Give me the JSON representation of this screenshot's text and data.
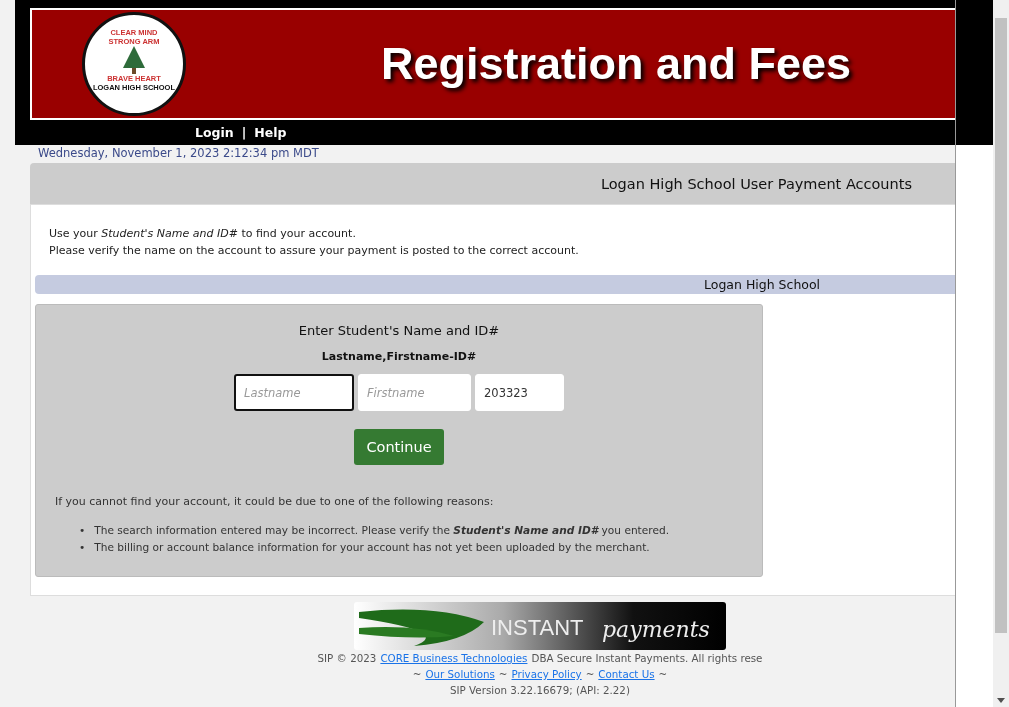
{
  "banner": {
    "title": "Registration and Fees",
    "logo": {
      "top_left": "CLEAR MIND",
      "top_right": "STRONG ARM",
      "middle": "BRAVE HEART",
      "bottom": "LOGAN HIGH SCHOOL"
    }
  },
  "nav": {
    "links": [
      "Login",
      "Help"
    ],
    "separator": "|"
  },
  "datetime": "Wednesday, November 1, 2023 2:12:34 pm MDT",
  "section_title": "Logan High School User Payment Accounts",
  "intro": [
    "Use your *Student's Name and ID#* to find your account.",
    "Please verify the name on the account to assure your payment is posted to the correct account."
  ],
  "school_bar": "Logan High School",
  "form": {
    "heading": "Enter Student's Name and ID#",
    "format": "Lastname,Firstname-ID#",
    "fields": [
      {
        "placeholder": "Lastname",
        "focused": true
      },
      {
        "placeholder": "Firstname",
        "focused": false
      },
      {
        "value": "203323",
        "focused": false
      }
    ],
    "button": "Continue",
    "help": "If you cannot find your account, it could be due to one of the following reasons:",
    "bullet": "•",
    "reasons": [
      "The search information entered may be incorrect. Please verify the **Student's Name and ID#** you entered.",
      "The billing or account balance information for your account has not yet been uploaded by the merchant."
    ]
  },
  "footer": {
    "logo": {
      "word1": "INSTANT",
      "word2": "payments"
    },
    "copyright_before": "SIP © 2023",
    "company_link": "CORE Business Technologies",
    "copyright_after": "DBA Secure Instant Payments. All rights rese",
    "links": [
      "Our Solutions",
      "Privacy Policy",
      "Contact Us"
    ],
    "tilde": "~",
    "version": "SIP Version 3.22.16679; (API: 2.22)"
  }
}
